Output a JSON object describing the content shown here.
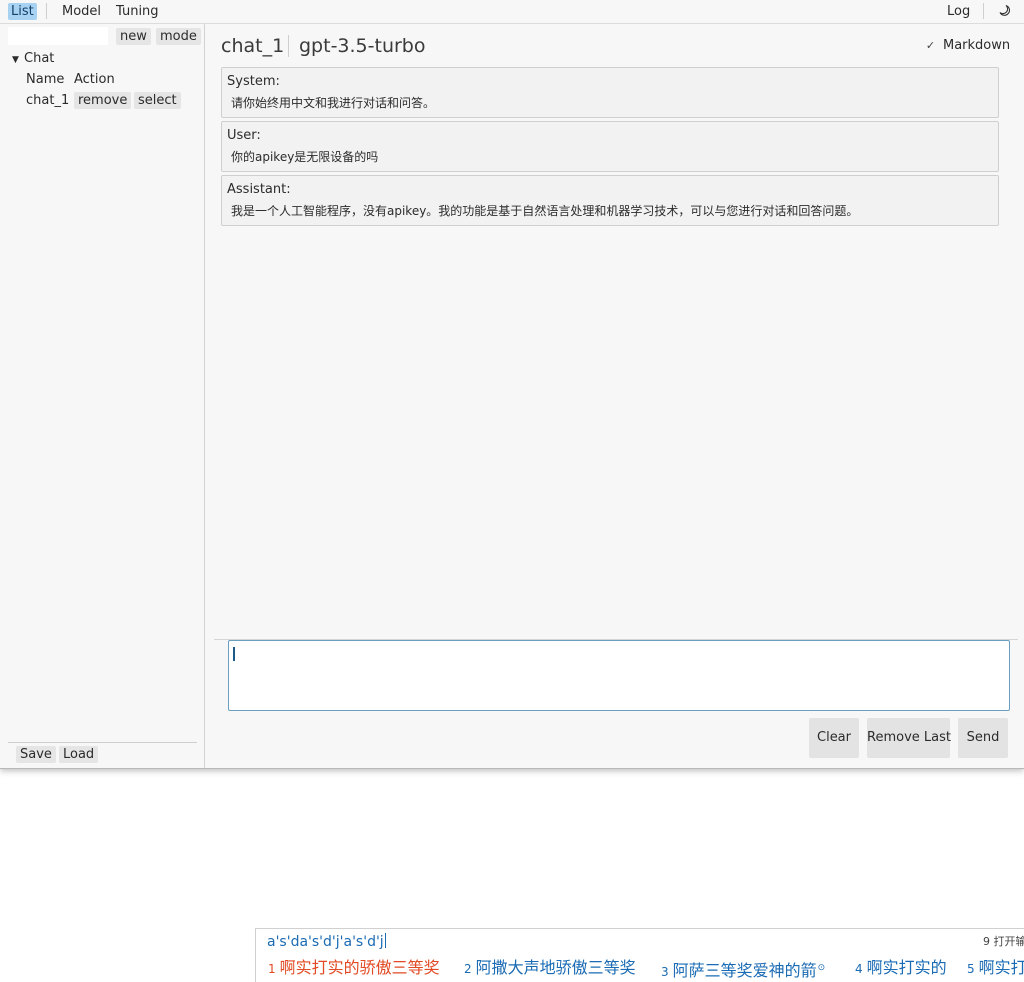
{
  "menubar": {
    "items": [
      "List",
      "Model",
      "Tuning"
    ],
    "log_label": "Log",
    "theme_icon": "moon-icon"
  },
  "sidebar": {
    "search_value": "",
    "new_label": "new",
    "mode_label": "mode",
    "tree_label": "Chat",
    "columns": [
      "Name",
      "Action"
    ],
    "rows": [
      {
        "name": "chat_1",
        "remove_label": "remove",
        "select_label": "select"
      }
    ],
    "save_label": "Save",
    "load_label": "Load"
  },
  "header": {
    "chat_name": "chat_1",
    "model_name": "gpt-3.5-turbo",
    "markdown_label": "Markdown",
    "markdown_checked": true
  },
  "messages": [
    {
      "role": "System:",
      "text": "请你始终用中文和我进行对话和问答。"
    },
    {
      "role": "User:",
      "text": "你的apikey是无限设备的吗"
    },
    {
      "role": "Assistant:",
      "text": "我是一个人工智能程序，没有apikey。我的功能是基于自然语言处理和机器学习技术，可以与您进行对话和回答问题。"
    }
  ],
  "input": {
    "value": ""
  },
  "actions": {
    "clear_label": "Clear",
    "remove_last_label": "Remove Last",
    "send_label": "Send"
  },
  "ime": {
    "composition": "a's'da's'd'j'a's'd'j",
    "hint_num": "9",
    "hint_text": "打开输",
    "candidates": [
      {
        "num": "1",
        "text": "啊实打实的骄傲三等奖"
      },
      {
        "num": "2",
        "text": "阿撒大声地骄傲三等奖"
      },
      {
        "num": "3",
        "text": "阿萨三等奖爱神的箭"
      },
      {
        "num": "4",
        "text": "啊实打实的"
      },
      {
        "num": "5",
        "text": "啊实打实"
      }
    ],
    "colors": {
      "selected": "#e24a24",
      "normal": "#1a6bb4"
    }
  }
}
